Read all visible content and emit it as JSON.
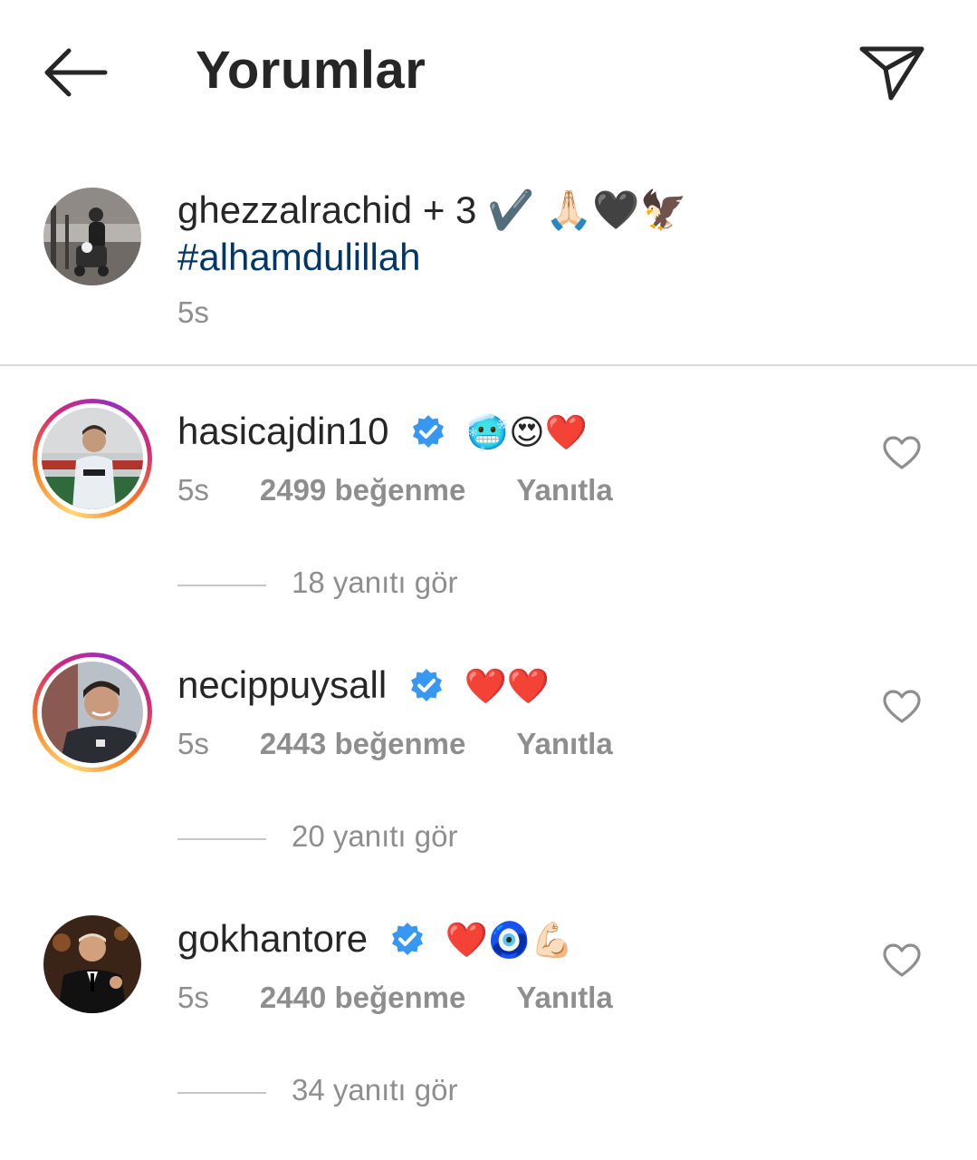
{
  "header": {
    "title": "Yorumlar",
    "back_icon": "arrow-left-icon",
    "share_icon": "paper-plane-icon"
  },
  "caption": {
    "username": "ghezzalrachid",
    "text": " + 3 ",
    "emojis": "✔️ 🙏🏻🖤🦅",
    "hashtag": "#alhamdulillah",
    "time": "5s"
  },
  "comments": [
    {
      "username": "hasicajdin10",
      "verified": true,
      "emojis": "🥶😍❤️",
      "time": "5s",
      "likes": "2499 beğenme",
      "reply_label": "Yanıtla",
      "view_replies": "18 yanıtı gör",
      "story_ring": true
    },
    {
      "username": "necippuysall",
      "verified": true,
      "emojis": "❤️❤️",
      "time": "5s",
      "likes": "2443 beğenme",
      "reply_label": "Yanıtla",
      "view_replies": "20 yanıtı gör",
      "story_ring": true
    },
    {
      "username": "gokhantore",
      "verified": true,
      "emojis": "❤️🧿💪🏻",
      "time": "5s",
      "likes": "2440 beğenme",
      "reply_label": "Yanıtla",
      "view_replies": "34 yanıtı gör",
      "story_ring": false
    }
  ],
  "colors": {
    "text": "#262626",
    "secondary": "#8e8e8e",
    "hashtag": "#00376b",
    "verified": "#3897f0",
    "divider": "#dbdbdb"
  }
}
